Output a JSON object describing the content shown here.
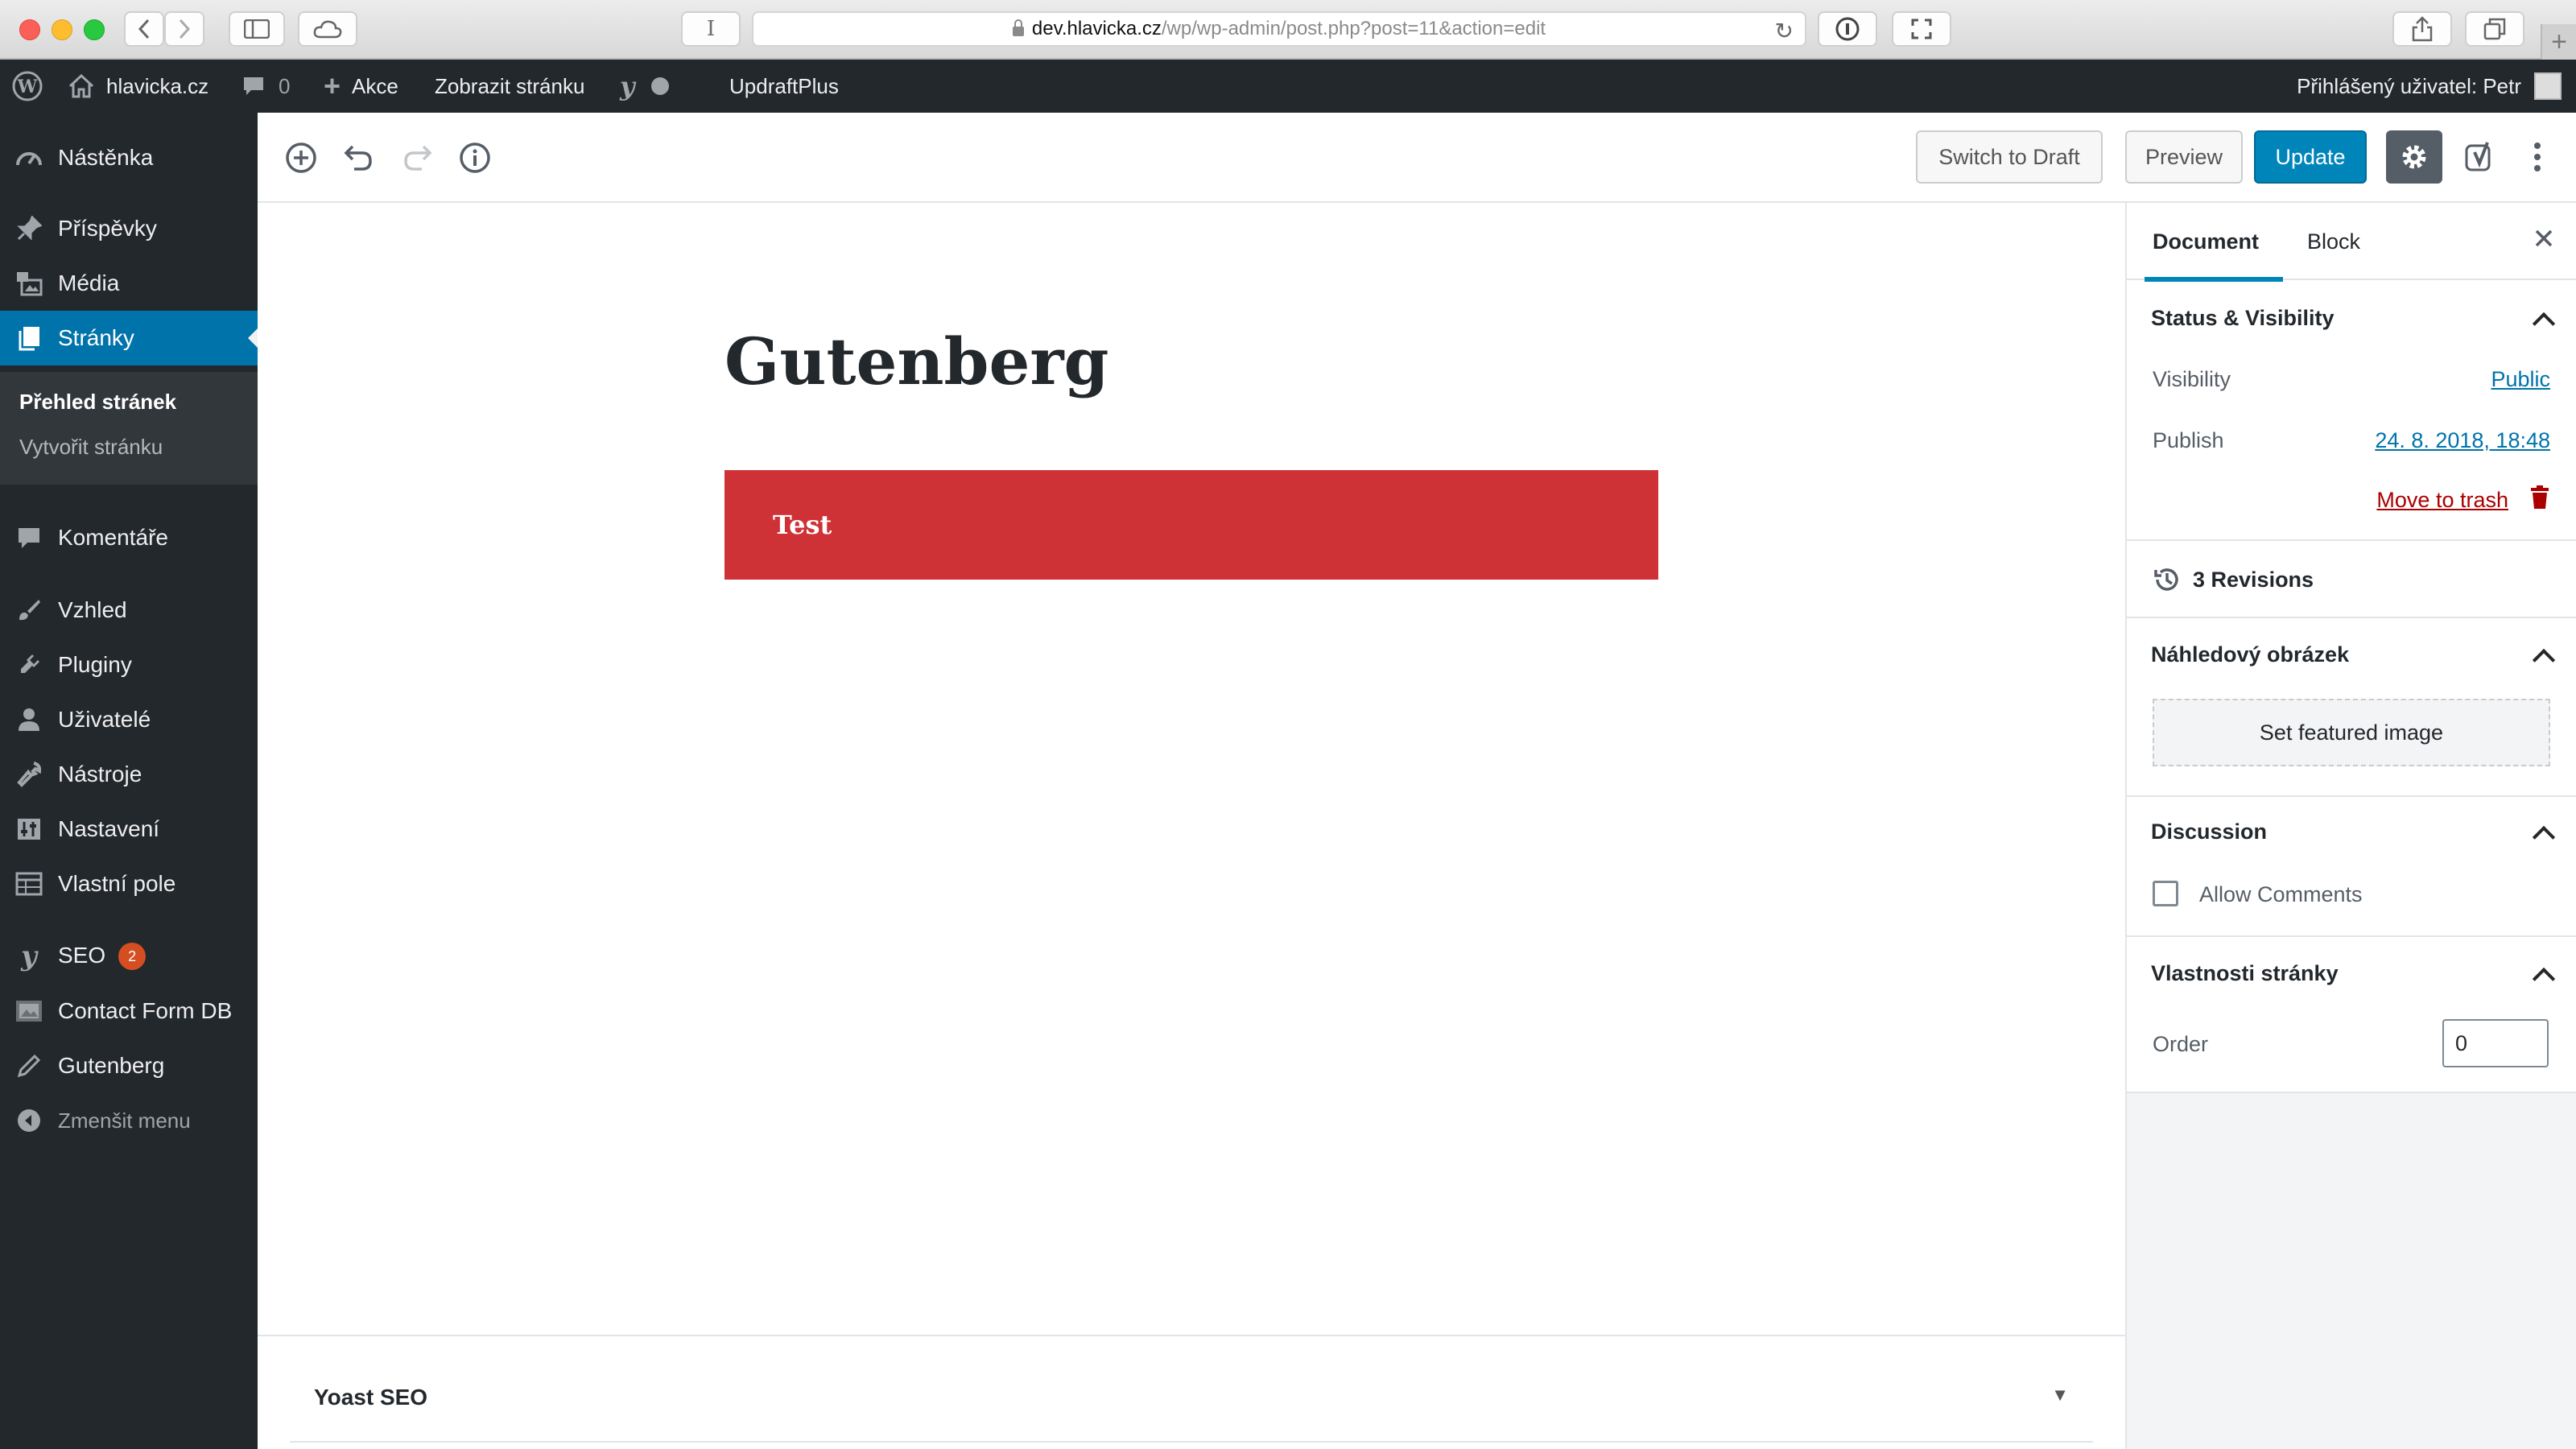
{
  "browser": {
    "url_host": "dev.hlavicka.cz",
    "url_path": "/wp/wp-admin/post.php?post=11&action=edit",
    "reader_label": "I"
  },
  "adminbar": {
    "site_name": "hlavicka.cz",
    "comments_count": "0",
    "new_label": "Akce",
    "view_label": "Zobrazit stránku",
    "updraft_label": "UpdraftPlus",
    "user_greeting": "Přihlášený uživatel: Petr"
  },
  "menu": {
    "items": [
      {
        "label": "Nástěnka"
      },
      {
        "label": "Příspěvky"
      },
      {
        "label": "Média"
      },
      {
        "label": "Stránky"
      },
      {
        "label": "Komentáře"
      },
      {
        "label": "Vzhled"
      },
      {
        "label": "Pluginy"
      },
      {
        "label": "Uživatelé"
      },
      {
        "label": "Nástroje"
      },
      {
        "label": "Nastavení"
      },
      {
        "label": "Vlastní pole"
      },
      {
        "label": "SEO"
      },
      {
        "label": "Contact Form DB"
      },
      {
        "label": "Gutenberg"
      },
      {
        "label": "Zmenšit menu"
      }
    ],
    "seo_badge": "2",
    "submenu": [
      {
        "label": "Přehled stránek"
      },
      {
        "label": "Vytvořit stránku"
      }
    ]
  },
  "toolbar": {
    "switch_draft": "Switch to Draft",
    "preview": "Preview",
    "update": "Update"
  },
  "post": {
    "title": "Gutenberg",
    "block_text": "Test"
  },
  "yoast": {
    "title": "Yoast SEO"
  },
  "sidebar": {
    "tab_document": "Document",
    "tab_block": "Block",
    "status_visibility": "Status & Visibility",
    "visibility_label": "Visibility",
    "visibility_value": "Public",
    "publish_label": "Publish",
    "publish_value": "24. 8. 2018, 18:48",
    "move_to_trash": "Move to trash",
    "revisions": "3 Revisions",
    "featured_title": "Náhledový obrázek",
    "featured_button": "Set featured image",
    "discussion_title": "Discussion",
    "allow_comments": "Allow Comments",
    "page_attributes_title": "Vlastnosti stránky",
    "order_label": "Order",
    "order_value": "0"
  },
  "colors": {
    "admin_dark": "#23282d",
    "admin_blue": "#0073aa",
    "primary_button": "#0085ba",
    "block_red": "#cf3236"
  }
}
